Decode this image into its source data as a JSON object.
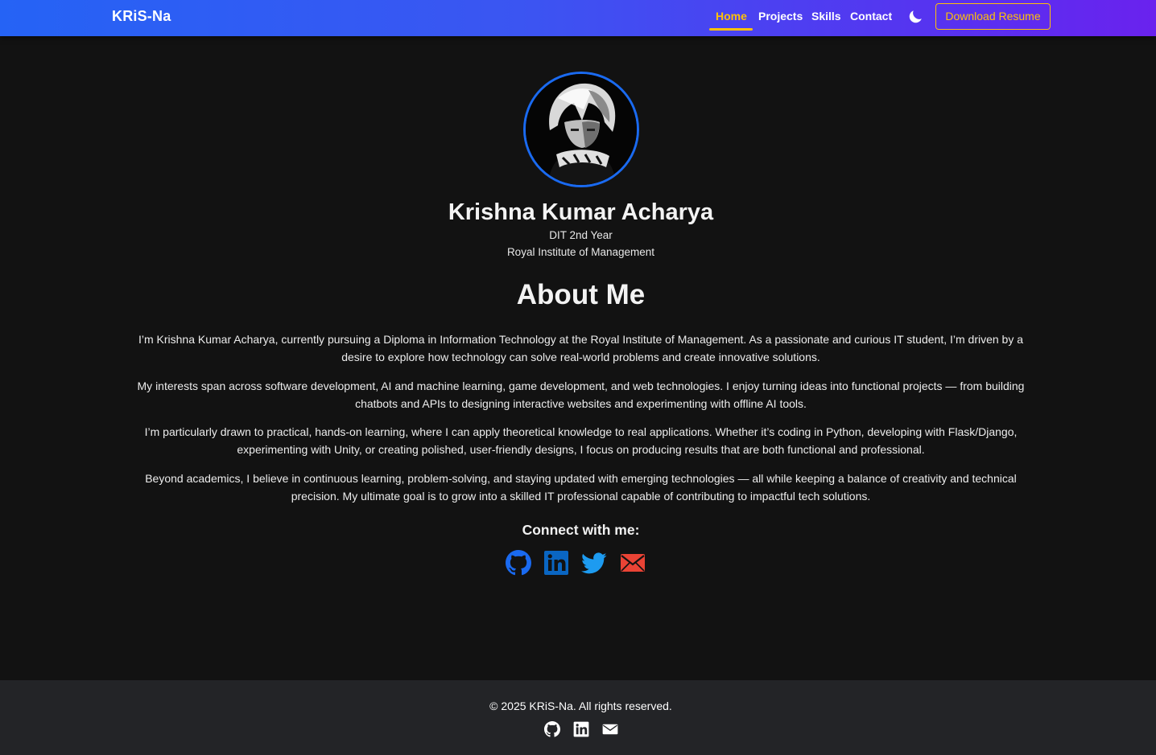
{
  "navbar": {
    "brand": "KRiS-Na",
    "links": [
      {
        "label": "Home",
        "active": true
      },
      {
        "label": "Projects",
        "active": false
      },
      {
        "label": "Skills",
        "active": false
      },
      {
        "label": "Contact",
        "active": false
      }
    ],
    "theme_toggle_icon": "moon-icon",
    "resume_button": "Download Resume"
  },
  "hero": {
    "name": "Krishna Kumar Acharya",
    "year": "DIT 2nd Year",
    "institute": "Royal Institute of Management"
  },
  "about": {
    "title": "About Me",
    "paragraphs": [
      "I’m Krishna Kumar Acharya, currently pursuing a Diploma in Information Technology at the Royal Institute of Management. As a passionate and curious IT student, I’m driven by a desire to explore how technology can solve real-world problems and create innovative solutions.",
      "My interests span across software development, AI and machine learning, game development, and web technologies. I enjoy turning ideas into functional projects — from building chatbots and APIs to designing interactive websites and experimenting with offline AI tools.",
      "I’m particularly drawn to practical, hands-on learning, where I can apply theoretical knowledge to real applications. Whether it’s coding in Python, developing with Flask/Django, experimenting with Unity, or creating polished, user-friendly designs, I focus on producing results that are both functional and professional.",
      "Beyond academics, I believe in continuous learning, problem-solving, and staying updated with emerging technologies — all while keeping a balance of creativity and technical precision. My ultimate goal is to grow into a skilled IT professional capable of contributing to impactful tech solutions."
    ]
  },
  "connect": {
    "title": "Connect with me:",
    "icons": [
      "github-icon",
      "linkedin-icon",
      "twitter-icon",
      "email-icon"
    ]
  },
  "footer": {
    "copyright": "© 2025 KRiS-Na. All rights reserved.",
    "icons": [
      "github-icon",
      "linkedin-icon",
      "email-icon"
    ]
  },
  "colors": {
    "accent": "#ffc107",
    "nav_gradient_start": "#2563f5",
    "nav_gradient_end": "#6a22ee",
    "background": "#121212",
    "footer": "#232427",
    "github": "#1a6af0",
    "linkedin": "#0a66c2",
    "twitter": "#1d9bf0",
    "email": "#ea4335"
  }
}
